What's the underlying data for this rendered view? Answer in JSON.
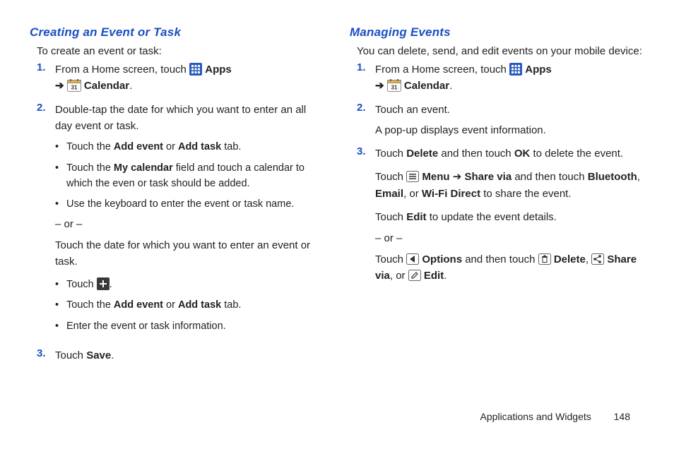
{
  "left": {
    "heading": "Creating an Event or Task",
    "intro": "To create an event or task:",
    "step1_a": "From a Home screen, touch ",
    "step1_apps": "Apps",
    "step1_arrow": "➔",
    "step1_cal": "Calendar",
    "step1_dot": ".",
    "step2": "Double-tap the date for which you want to enter an all day event or task.",
    "b1_a": "Touch the ",
    "b1_b": "Add event",
    "b1_c": " or ",
    "b1_d": "Add task",
    "b1_e": " tab.",
    "b2_a": "Touch the ",
    "b2_b": "My calendar",
    "b2_c": " field and touch a calendar to which the even or task should be added.",
    "b3": "Use the keyboard to enter the event or task name.",
    "or": "– or –",
    "afteror": "Touch the date for which you want to enter an event or task.",
    "c1_a": "Touch ",
    "c1_b": ".",
    "c2_a": "Touch the ",
    "c2_b": "Add event",
    "c2_c": " or ",
    "c2_d": "Add task",
    "c2_e": " tab.",
    "c3": "Enter the event or task information.",
    "step3_a": "Touch ",
    "step3_b": "Save",
    "step3_c": "."
  },
  "right": {
    "heading": "Managing Events",
    "intro": "You can delete, send, and edit events on your mobile device:",
    "step1_a": "From a Home screen, touch ",
    "step1_apps": "Apps",
    "step1_arrow": "➔",
    "step1_cal": "Calendar",
    "step1_dot": ".",
    "step2_l1": "Touch an event.",
    "step2_l2": "A pop-up displays event information.",
    "s3_a": "Touch ",
    "s3_b": "Delete",
    "s3_c": " and then touch ",
    "s3_d": "OK",
    "s3_e": " to delete the event.",
    "p2_a": "Touch ",
    "p2_b": "Menu",
    "p2_c": " ➔ ",
    "p2_d": "Share via",
    "p2_e": " and then touch ",
    "p2_f": "Bluetooth",
    "p2_g": ", ",
    "p2_h": "Email",
    "p2_i": ", or ",
    "p2_j": "Wi-Fi Direct",
    "p2_k": " to share the event.",
    "p3_a": "Touch ",
    "p3_b": "Edit",
    "p3_c": " to update the event details.",
    "or": "– or –",
    "p4_a": "Touch ",
    "p4_b": "Options",
    "p4_c": " and then touch ",
    "p4_d": "Delete",
    "p4_e": ", ",
    "p4_f": "Share via",
    "p4_g": ", or ",
    "p4_h": "Edit",
    "p4_i": "."
  },
  "footer": {
    "section": "Applications and Widgets",
    "page": "148"
  },
  "nums": {
    "n1": "1.",
    "n2": "2.",
    "n3": "3."
  },
  "bullet": "•"
}
